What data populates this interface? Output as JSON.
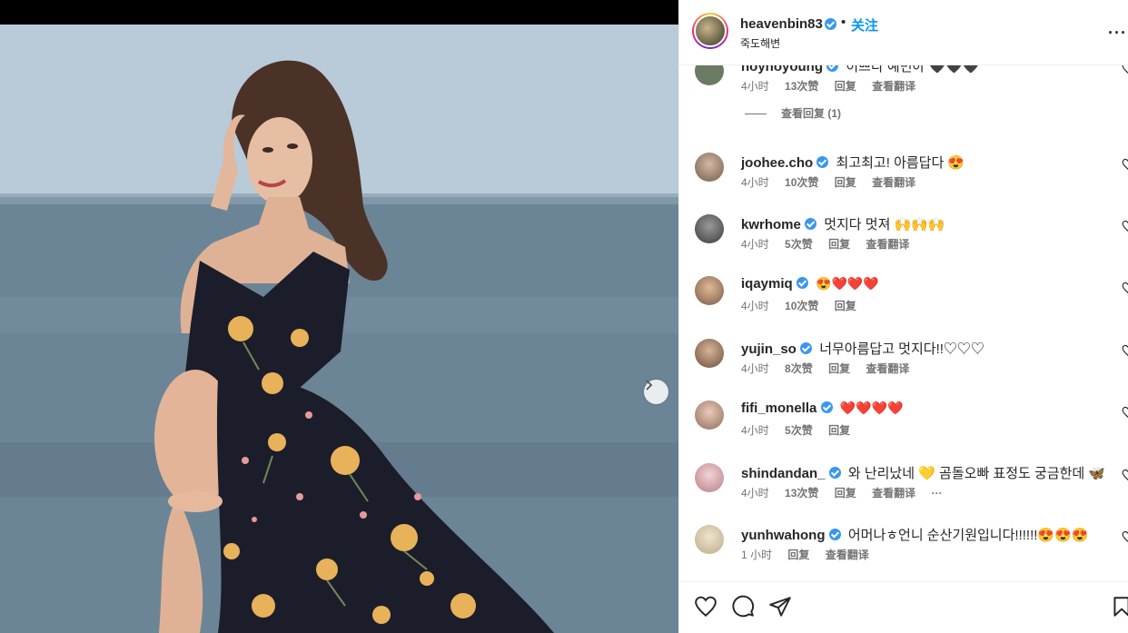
{
  "post": {
    "username": "heavenbin83",
    "follow_label": "关注",
    "separator": "•",
    "location": "죽도해변",
    "more_label": "···"
  },
  "comments": [
    {
      "user": "hoyhoyoung",
      "text": "이쁘다 예빈아 🖤🖤🖤",
      "time": "4小时",
      "likes": "13次赞",
      "reply": "回复",
      "translate": "查看翻译",
      "avatar_color": "#6b7a62",
      "heart": "#262626"
    },
    {
      "user": "joohee.cho",
      "text": "최고최고! 아름답다 😍",
      "time": "4小时",
      "likes": "10次赞",
      "reply": "回复",
      "translate": "查看翻译",
      "avatar_color": "#8a7c70"
    },
    {
      "user": "kwrhome",
      "text": "멋지다 멋져 🙌🙌🙌",
      "time": "4小时",
      "likes": "5次赞",
      "reply": "回复",
      "translate": "查看翻译",
      "avatar_color": "#5a5a5a"
    },
    {
      "user": "iqaymiq",
      "text": "😍❤️❤️❤️",
      "time": "4小时",
      "likes": "10次赞",
      "reply": "回复",
      "translate": "",
      "avatar_color": "#a8836a"
    },
    {
      "user": "yujin_so",
      "text": "너무아름답고 멋지다!!♡♡♡",
      "time": "4小时",
      "likes": "8次赞",
      "reply": "回复",
      "translate": "查看翻译",
      "avatar_color": "#9a7a65"
    },
    {
      "user": "fifi_monella",
      "text": "❤️❤️❤️❤️",
      "time": "4小时",
      "likes": "5次赞",
      "reply": "回复",
      "translate": "",
      "avatar_color": "#b8968a"
    },
    {
      "user": "shindandan_",
      "text": "와 난리났네 💛 곰돌오빠 표정도 궁금한데 🦋",
      "time": "4小时",
      "likes": "13次赞",
      "reply": "回复",
      "translate": "查看翻译",
      "extra": "···",
      "avatar_color": "#c48b8f"
    },
    {
      "user": "yunhwahong",
      "text": "어머나ㅎ언니 순산기원입니다!!!!!!😍😍😍",
      "time": "1 小时",
      "likes": "",
      "reply": "回复",
      "translate": "查看翻译",
      "avatar_color": "#cfc6b0"
    }
  ],
  "replies_toggle": "查看回复 (1)"
}
